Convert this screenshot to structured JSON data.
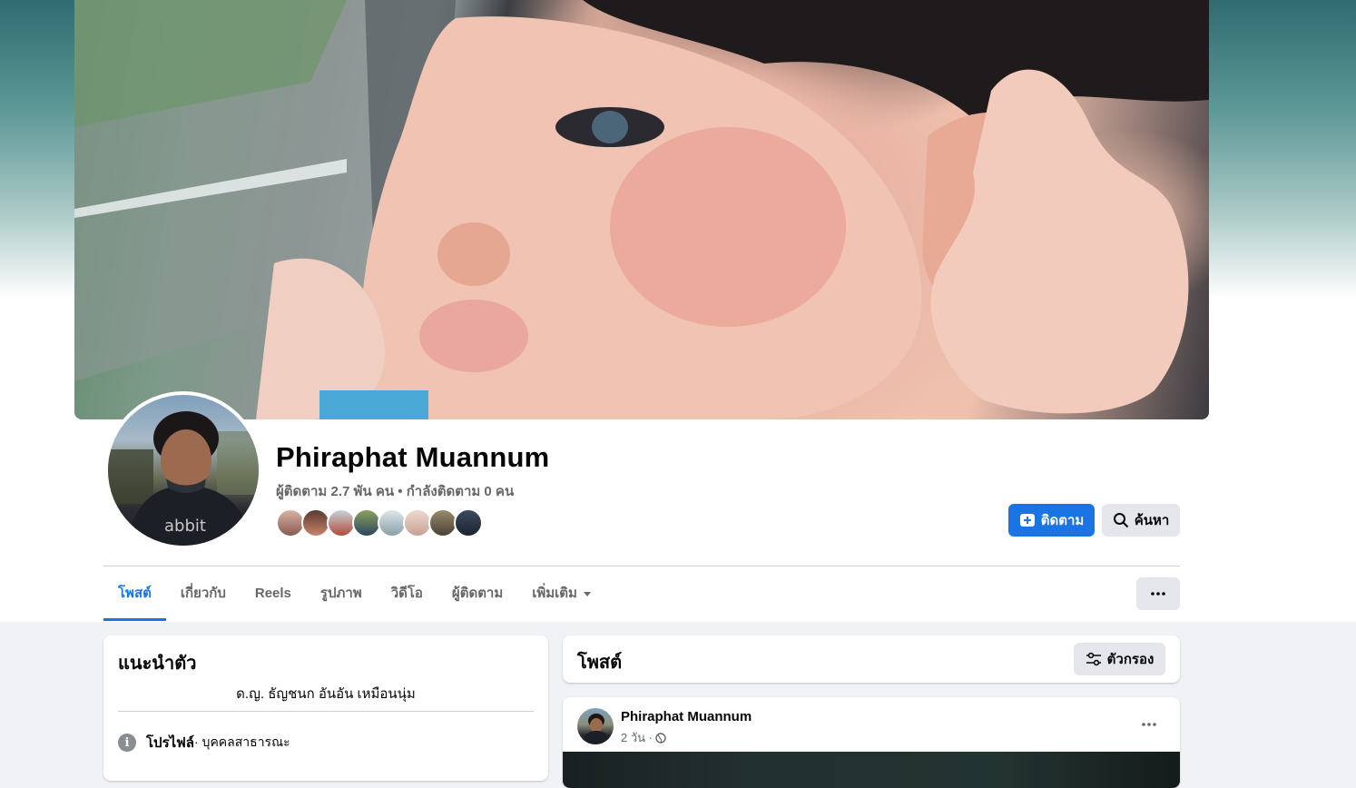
{
  "profile": {
    "name": "Phiraphat Muannum",
    "stats": "ผู้ติดตาม 2.7 พัน คน • กำลังติดตาม 0 คน"
  },
  "actions": {
    "follow_label": "ติดตาม",
    "search_label": "ค้นหา"
  },
  "tabs": [
    {
      "label": "โพสต์",
      "active": true
    },
    {
      "label": "เกี่ยวกับ"
    },
    {
      "label": "Reels"
    },
    {
      "label": "รูปภาพ"
    },
    {
      "label": "วิดีโอ"
    },
    {
      "label": "ผู้ติดตาม"
    },
    {
      "label": "เพิ่มเติม"
    }
  ],
  "intro": {
    "title": "แนะนำตัว",
    "bio": "ด.ญ. ธัญชนก อันอัน เหมือนนุ่ม",
    "profile_label": "โปรไฟล์",
    "profile_type": " · บุคคลสาธารณะ"
  },
  "posts_section": {
    "title": "โพสต์",
    "filter_label": "ตัวกรอง"
  },
  "post": {
    "author": "Phiraphat Muannum",
    "time": "2 วัน ·"
  },
  "colors": {
    "accent": "#1b74e4",
    "secondary_text": "#65676b",
    "button_gray": "#e4e6eb"
  },
  "icons": [
    "info-icon",
    "follow-plus-icon",
    "search-icon",
    "filter-icon",
    "globe-icon",
    "more-dots-icon",
    "dropdown-arrow-icon"
  ]
}
